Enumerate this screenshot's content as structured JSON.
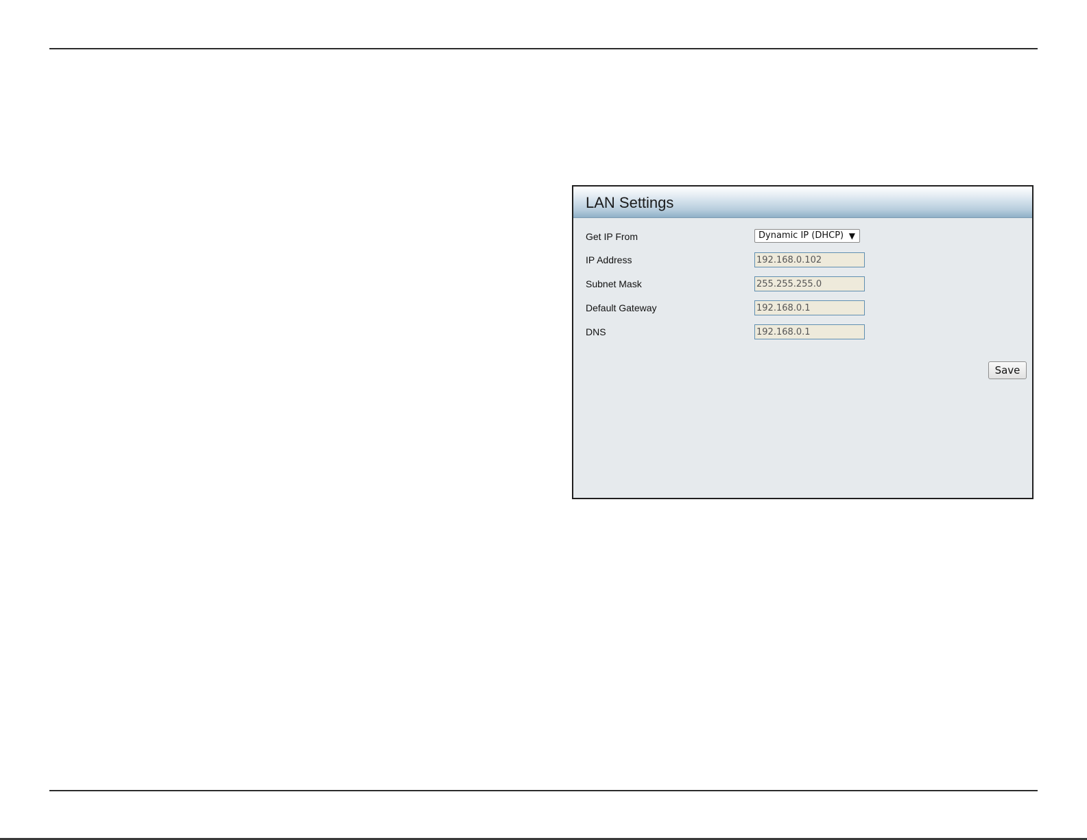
{
  "panel": {
    "title": "LAN Settings"
  },
  "form": {
    "get_ip_from": {
      "label": "Get IP From",
      "selected": "Dynamic IP (DHCP)"
    },
    "ip_address": {
      "label": "IP Address",
      "value": "192.168.0.102"
    },
    "subnet_mask": {
      "label": "Subnet Mask",
      "value": "255.255.255.0"
    },
    "default_gateway": {
      "label": "Default Gateway",
      "value": "192.168.0.1"
    },
    "dns": {
      "label": "DNS",
      "value": "192.168.0.1"
    }
  },
  "actions": {
    "save_label": "Save"
  },
  "icons": {
    "dropdown": "chevron-down-icon"
  },
  "colors": {
    "panel_background": "#e6eaed",
    "header_gradient_end": "#8fb0c7",
    "input_background": "#eeeadb",
    "input_border": "#5f8fb0"
  }
}
